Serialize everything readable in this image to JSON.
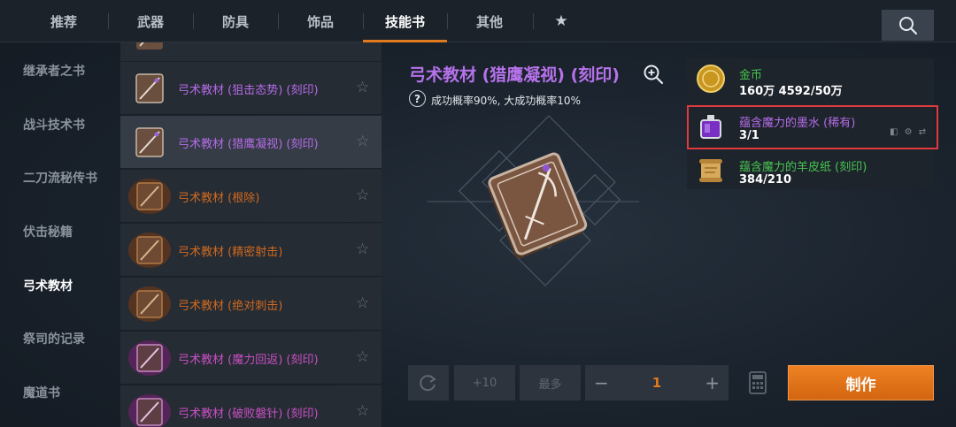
{
  "tabs": [
    {
      "label": "推荐"
    },
    {
      "label": "武器"
    },
    {
      "label": "防具"
    },
    {
      "label": "饰品"
    },
    {
      "label": "技能书"
    },
    {
      "label": "其他"
    }
  ],
  "active_tab": "技能书",
  "categories": [
    {
      "label": "继承者之书"
    },
    {
      "label": "战斗技术书"
    },
    {
      "label": "二刀流秘传书"
    },
    {
      "label": "伏击秘籍"
    },
    {
      "label": "弓术教材"
    },
    {
      "label": "祭司的记录"
    },
    {
      "label": "魔道书"
    }
  ],
  "active_category": "弓术教材",
  "items": [
    {
      "name": "弓术教材 (狙击态势) (刻印)"
    },
    {
      "name": "弓术教材 (猎鹰凝视) (刻印)"
    },
    {
      "name": "弓术教材 (根除)"
    },
    {
      "name": "弓术教材 (精密射击)"
    },
    {
      "name": "弓术教材 (绝对刺击)"
    },
    {
      "name": "弓术教材 (魔力回返) (刻印)"
    },
    {
      "name": "弓术教材 (破败磐针) (刻印)"
    }
  ],
  "detail": {
    "title": "弓术教材 (猎鹰凝视) (刻印)",
    "rate_text": "成功概率90%, 大成功概率10%",
    "help_glyph": "?"
  },
  "materials": [
    {
      "name": "金币",
      "count": "160万 4592/50万"
    },
    {
      "name": "蕴含魔力的墨水 (稀有)",
      "count": "3/1"
    },
    {
      "name": "蕴含魔力的羊皮纸 (刻印)",
      "count": "384/210"
    }
  ],
  "controls": {
    "plus10": "+10",
    "max": "最多",
    "minus": "−",
    "plus": "+",
    "quantity": "1",
    "make": "制作"
  },
  "colors": {
    "accent": "#e07a1e",
    "rare_purple": "#b56be8",
    "highlight_red": "#e0393e",
    "material_green": "#47c44f"
  }
}
